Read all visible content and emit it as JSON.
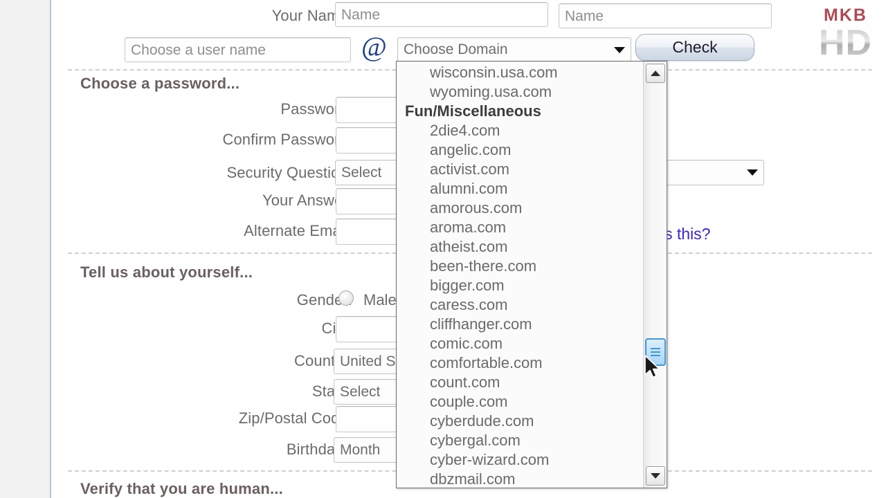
{
  "watermark": {
    "top_text": "MKB",
    "bottom_text": "HD"
  },
  "form": {
    "name_row": {
      "label": "Your Name:",
      "first_placeholder": "Name",
      "last_placeholder": "Name"
    },
    "username_row": {
      "username_placeholder": "Choose a user name",
      "at_symbol": "@",
      "domain_select_value": "Choose Domain",
      "check_button_label": "Check"
    },
    "password_section": {
      "heading": "Choose a password...",
      "rows": [
        {
          "label": "Password:",
          "value": ""
        },
        {
          "label": "Confirm Password:",
          "value": ""
        },
        {
          "label": "Security Question:",
          "value": "Select"
        },
        {
          "label": "Your Answer:",
          "value": ""
        },
        {
          "label": "Alternate Email:",
          "value": ""
        }
      ],
      "whats_this_link": "what's this?"
    },
    "about_section": {
      "heading": "Tell us about yourself...",
      "gender_label": "Gender:",
      "gender_option": "Male",
      "rows": [
        {
          "label": "City:",
          "value": ""
        },
        {
          "label": "Country:",
          "value": "United States"
        },
        {
          "label": "State:",
          "value": "Select"
        },
        {
          "label": "Zip/Postal Code:",
          "value": ""
        },
        {
          "label": "Birthdate:",
          "value": "Month"
        }
      ]
    },
    "verify_section": {
      "heading": "Verify that you are human..."
    }
  },
  "dropdown": {
    "open": true,
    "options": [
      {
        "text": "wisconsin.usa.com",
        "group": false
      },
      {
        "text": "wyoming.usa.com",
        "group": false
      },
      {
        "text": "Fun/Miscellaneous",
        "group": true
      },
      {
        "text": "2die4.com",
        "group": false
      },
      {
        "text": "angelic.com",
        "group": false
      },
      {
        "text": "activist.com",
        "group": false
      },
      {
        "text": "alumni.com",
        "group": false
      },
      {
        "text": "amorous.com",
        "group": false
      },
      {
        "text": "aroma.com",
        "group": false
      },
      {
        "text": "atheist.com",
        "group": false
      },
      {
        "text": "been-there.com",
        "group": false
      },
      {
        "text": "bigger.com",
        "group": false
      },
      {
        "text": "caress.com",
        "group": false
      },
      {
        "text": "cliffhanger.com",
        "group": false
      },
      {
        "text": "comic.com",
        "group": false
      },
      {
        "text": "comfortable.com",
        "group": false
      },
      {
        "text": "count.com",
        "group": false
      },
      {
        "text": "couple.com",
        "group": false
      },
      {
        "text": "cyberdude.com",
        "group": false
      },
      {
        "text": "cybergal.com",
        "group": false
      },
      {
        "text": "cyber-wizard.com",
        "group": false
      },
      {
        "text": "dbzmail.com",
        "group": false
      }
    ],
    "scrollbar": {
      "up_icon": "scroll-up-arrow",
      "down_icon": "scroll-down-arrow",
      "thumb_position_percent": 66
    }
  },
  "colors": {
    "link": "#3b1fd4",
    "at_symbol": "#1f3f8f",
    "watermark_top": "#b04a52",
    "scrollbar_thumb_accent": "#3f97d6"
  }
}
